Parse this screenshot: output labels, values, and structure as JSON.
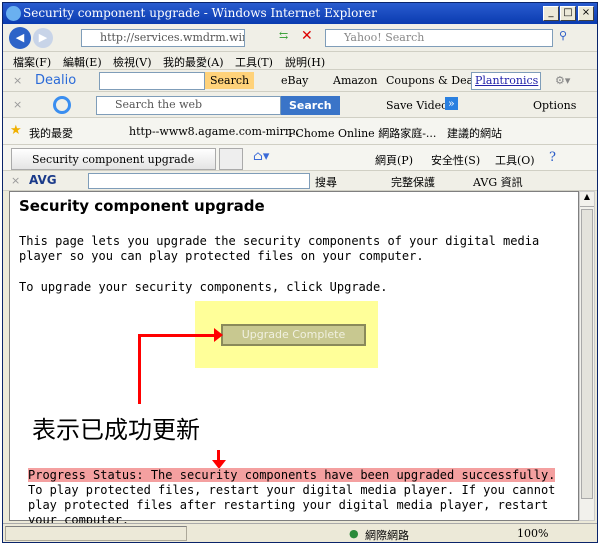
{
  "window": {
    "title": "Security component upgrade - Windows Internet Explorer"
  },
  "address": {
    "url": "http://services.wmdrm.wind...",
    "search_placeholder": "Yahoo! Search"
  },
  "menu": [
    "檔案(F)",
    "編輯(E)",
    "檢視(V)",
    "我的最愛(A)",
    "工具(T)",
    "說明(H)"
  ],
  "dealio": {
    "brand": "Dealio",
    "search_label": "Search",
    "ebay": "eBay",
    "amazon": "Amazon",
    "coupons": "Coupons & Deals",
    "dropdown": "Plantronics"
  },
  "ask": {
    "placeholder": "Search the web",
    "search_label": "Search",
    "save_video": "Save Video",
    "options": "Options"
  },
  "favorites": {
    "label": "我的最愛",
    "items": [
      "http--www8.agame.com-mirr...",
      "PChome Online 網路家庭-...",
      "建議的網站"
    ]
  },
  "tab": {
    "label": "Security component upgrade"
  },
  "commandbar": [
    "網頁(P)",
    "安全性(S)",
    "工具(O)"
  ],
  "avg": {
    "brand": "AVG",
    "search_label": "搜尋",
    "protect": "完整保護",
    "news": "AVG 資訊"
  },
  "page": {
    "heading": "Security component upgrade",
    "intro": "This page lets you upgrade the security components of your digital media player so you can play protected files on your computer.",
    "instruction": "To upgrade your security components, click Upgrade.",
    "button_label": "Upgrade Complete",
    "annotation": "表示已成功更新",
    "status_highlight": "Progress Status: The security components have been upgraded successfully.",
    "status_rest": " To play protected files, restart your digital media player. If you cannot play protected files after restarting your digital media player, restart your computer."
  },
  "statusbar": {
    "zone": "網際網路",
    "zoom": "100%"
  },
  "colors": {
    "highlight_yellow": "#ffff99",
    "highlight_pink": "#f4a0a0",
    "arrow": "#ff0000"
  }
}
